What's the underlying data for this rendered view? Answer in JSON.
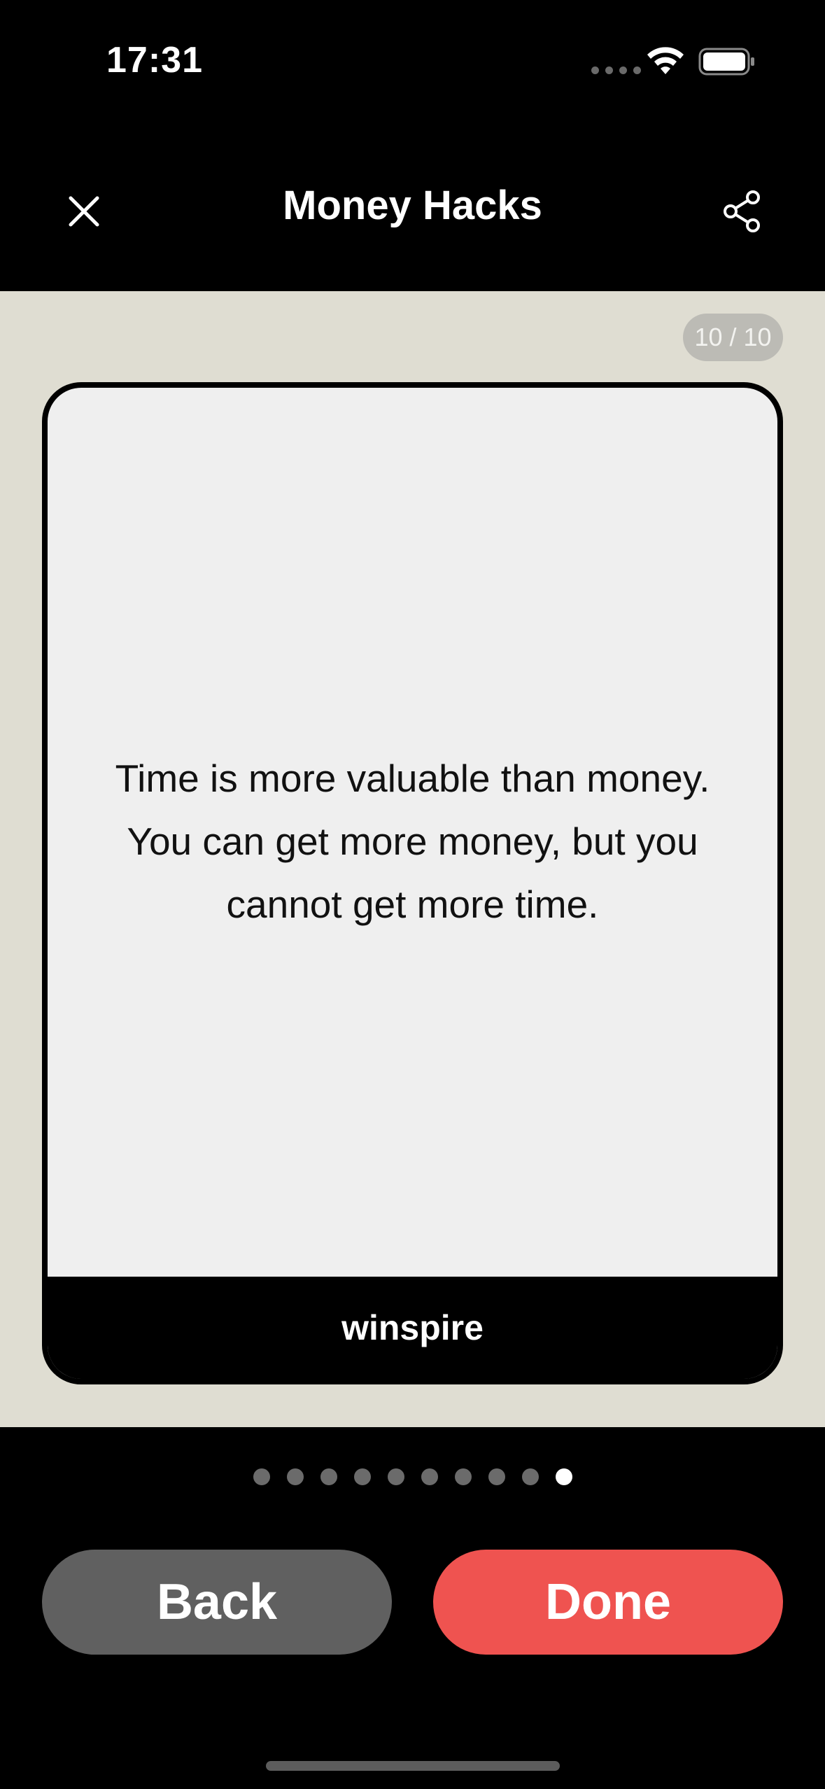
{
  "status_bar": {
    "time": "17:31",
    "wifi_icon": "wifi-icon",
    "battery_icon": "battery-icon"
  },
  "nav": {
    "title": "Money Hacks",
    "close_icon": "close-icon",
    "share_icon": "share-icon"
  },
  "card": {
    "counter": "10 / 10",
    "text": "Time is more valuable than money. You can get more money, but you cannot get more time.",
    "brand": "winspire"
  },
  "pager": {
    "total": 10,
    "current": 10
  },
  "buttons": {
    "back_label": "Back",
    "done_label": "Done"
  },
  "colors": {
    "content_bg": "#dfddd2",
    "card_bg": "#efefef",
    "back_button": "#606060",
    "done_button": "#ef5350"
  }
}
